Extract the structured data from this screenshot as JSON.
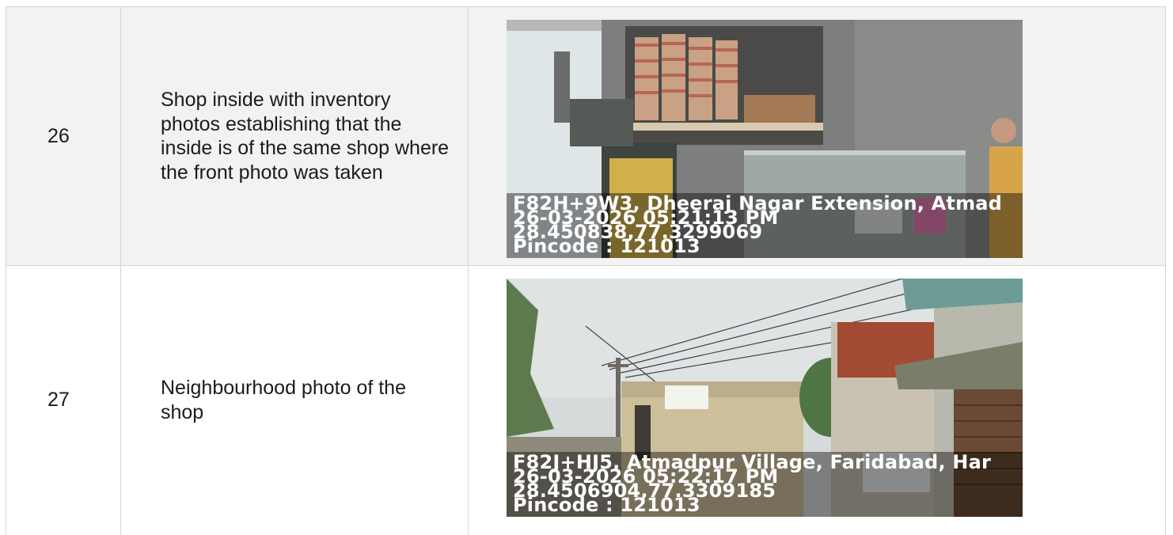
{
  "rows": [
    {
      "number": "26",
      "description": "Shop inside with inventory photos establishing that the inside is of the same shop where the front photo was taken",
      "photo": {
        "subject": "shop interior with shelf of boxed inventory and glass display counter",
        "stamp": {
          "address": "F82H+9W3, Dheeraj Nagar Extension, Atmad",
          "datetime": "26-03-2026 05:21:13 PM",
          "coordinates": "28.450838,77.3299069",
          "pincode": "Pincode : 121013"
        }
      }
    },
    {
      "number": "27",
      "description": "Neighbourhood photo of the shop",
      "photo": {
        "subject": "street view with power lines, school building and shop shutter",
        "stamp": {
          "address": "F82J+HJ5, Atmadpur Village, Faridabad, Har",
          "datetime": "26-03-2026 05:22:17 PM",
          "coordinates": "28.4506904,77.3309185",
          "pincode": "Pincode : 121013"
        }
      }
    }
  ],
  "colors": {
    "row_alt_bg": "#f2f2f2",
    "border": "#d4d4d4",
    "text": "#1b1b1b"
  }
}
